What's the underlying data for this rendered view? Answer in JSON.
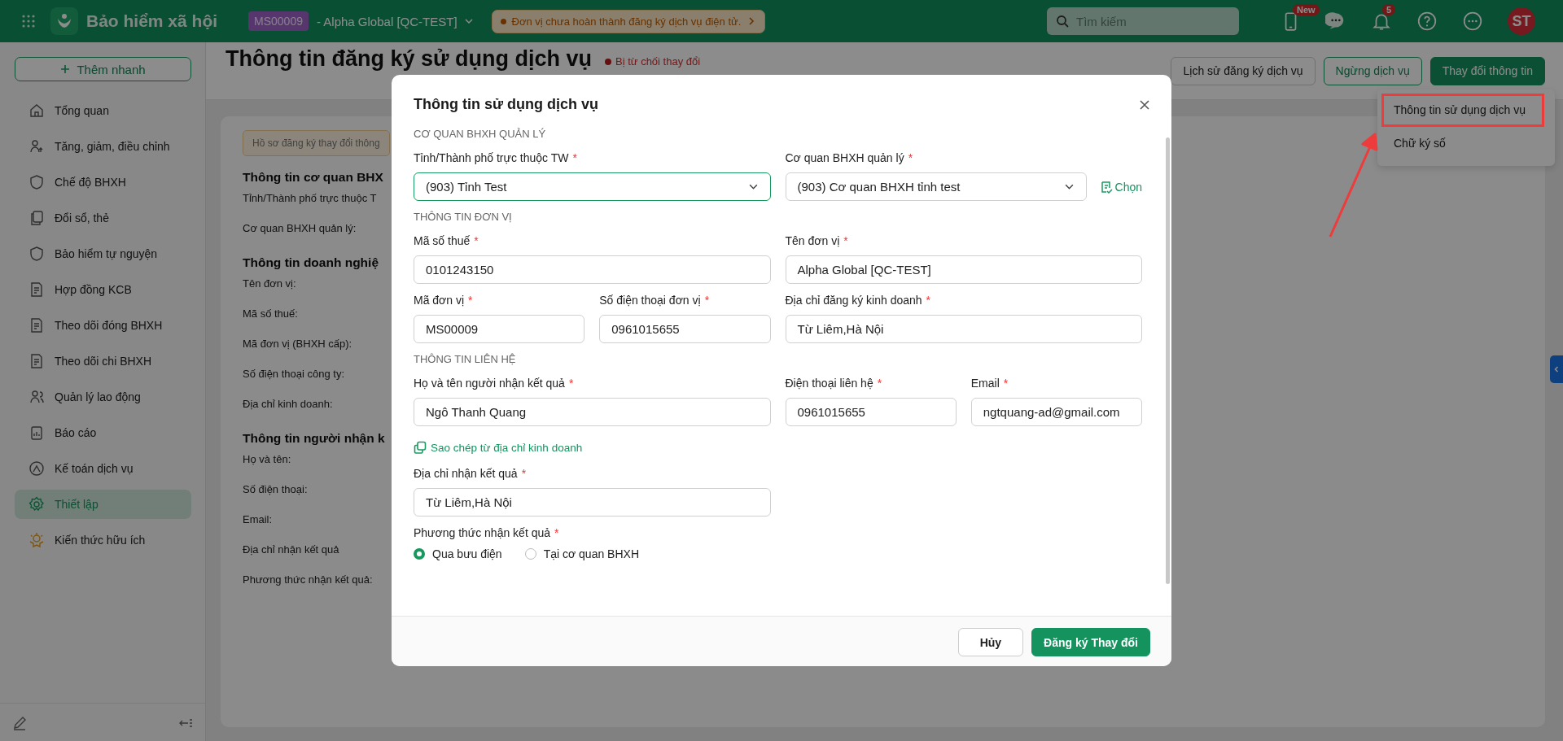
{
  "topbar": {
    "app_title": "Bảo hiểm xã hội",
    "unit_code": "MS00009",
    "unit_name": "- Alpha Global [QC-TEST]",
    "notice": "Đơn vị chưa hoàn thành đăng ký dịch vụ điện tử.",
    "search": {
      "placeholder": "Tìm kiếm"
    },
    "new_badge": "New",
    "notification_count": "5",
    "avatar": "ST"
  },
  "sidebar": {
    "quick_add": "Thêm nhanh",
    "items": [
      {
        "label": "Tổng quan",
        "selected": false
      },
      {
        "label": "Tăng, giảm, điều chỉnh",
        "selected": false
      },
      {
        "label": "Chế độ BHXH",
        "selected": false
      },
      {
        "label": "Đổi sổ, thẻ",
        "selected": false
      },
      {
        "label": "Bảo hiểm tự nguyện",
        "selected": false
      },
      {
        "label": "Hợp đồng KCB",
        "selected": false
      },
      {
        "label": "Theo dõi đóng BHXH",
        "selected": false
      },
      {
        "label": "Theo dõi chi BHXH",
        "selected": false
      },
      {
        "label": "Quản lý lao động",
        "selected": false
      },
      {
        "label": "Báo cáo",
        "selected": false
      },
      {
        "label": "Kế toán dịch vụ",
        "selected": false
      },
      {
        "label": "Thiết lập",
        "selected": true
      },
      {
        "label": "Kiến thức hữu ích",
        "selected": false
      }
    ]
  },
  "page": {
    "title": "Thông tin đăng ký sử dụng dịch vụ",
    "status": "Bị từ chối thay đổi",
    "actions": [
      {
        "label": "Lịch sử đăng ký dịch vụ",
        "kind": "default"
      },
      {
        "label": "Ngừng dịch vụ",
        "kind": "outline"
      },
      {
        "label": "Thay đổi thông tin",
        "kind": "primary"
      }
    ],
    "menu": [
      {
        "label": "Thông tin sử dụng dịch vụ",
        "highlighted": true
      },
      {
        "label": "Chữ ký số",
        "highlighted": false
      }
    ]
  },
  "card": {
    "notice": "Hồ sơ đăng ký thay đổi thông",
    "sections": [
      {
        "heading": "Thông tin cơ quan BHX",
        "labels": [
          "Tỉnh/Thành phố trực thuộc T",
          "Cơ quan BHXH quản lý:"
        ]
      },
      {
        "heading": "Thông tin doanh nghiệ",
        "labels": [
          "Tên đơn vị:",
          "Mã số thuế:",
          "Mã đơn vị (BHXH cấp):",
          "Số điện thoại công ty:",
          "Địa chỉ kinh doanh:"
        ]
      },
      {
        "heading": "Thông tin người nhận k",
        "labels": [
          "Họ và tên:",
          "Số điện thoại:",
          "Email:",
          "Địa chỉ nhận kết quả",
          "Phương thức nhận kết quả:"
        ]
      }
    ]
  },
  "modal": {
    "title": "Thông tin sử dụng dịch vụ",
    "sections": [
      {
        "heading": "CƠ QUAN BHXH QUẢN LÝ",
        "fields": [
          {
            "kind": "select",
            "label": "Tỉnh/Thành phố trực thuộc TW",
            "required_mark": "*",
            "value": "(903) Tỉnh Test",
            "focused": true
          },
          {
            "kind": "select",
            "label": "Cơ quan BHXH quản lý",
            "required_mark": "*",
            "value": "(903) Cơ quan BHXH tỉnh test",
            "focused": false,
            "action": "Chọn"
          }
        ]
      },
      {
        "heading": "THÔNG TIN ĐƠN VỊ",
        "fields": [
          {
            "kind": "input",
            "label": "Mã số thuế",
            "required_mark": "*",
            "value": "0101243150",
            "focused": false
          },
          {
            "kind": "input",
            "label": "Tên đơn vị",
            "required_mark": "*",
            "value": "Alpha Global [QC-TEST]",
            "focused": false
          },
          {
            "kind": "input",
            "label": "Mã đơn vị",
            "required_mark": "*",
            "value": "MS00009",
            "focused": false
          },
          {
            "kind": "input",
            "label": "Số điện thoại đơn vị",
            "required_mark": "*",
            "value": "0961015655",
            "focused": false
          },
          {
            "kind": "input",
            "label": "Địa chỉ đăng ký kinh doanh",
            "required_mark": "*",
            "value": "Từ Liêm,Hà Nội",
            "focused": false
          }
        ]
      },
      {
        "heading": "THÔNG TIN LIÊN HỆ",
        "fields": [
          {
            "kind": "input",
            "label": "Họ và tên người nhận kết quả",
            "required_mark": "*",
            "value": "Ngô Thanh Quang",
            "focused": false
          },
          {
            "kind": "input",
            "label": "Điện thoại liên hệ",
            "required_mark": "*",
            "value": "0961015655",
            "focused": false
          },
          {
            "kind": "input",
            "label": "Email",
            "required_mark": "*",
            "value": "ngtquang-ad@gmail.com",
            "focused": false
          },
          {
            "kind": "link",
            "label": "Sao chép từ địa chỉ kinh doanh"
          },
          {
            "kind": "input",
            "label": "Địa chỉ nhận kết quả",
            "required_mark": "*",
            "value": "Từ Liêm,Hà Nội",
            "focused": false
          },
          {
            "kind": "radio",
            "label": "Phương thức nhận kết quả",
            "required_mark": "*",
            "options": [
              {
                "label": "Qua bưu điện",
                "selected": true
              },
              {
                "label": "Tại cơ quan BHXH",
                "selected": false
              }
            ]
          }
        ]
      }
    ],
    "buttons": [
      {
        "label": "Hủy",
        "kind": "secondary"
      },
      {
        "label": "Đăng ký Thay đổi",
        "kind": "primary"
      }
    ]
  }
}
